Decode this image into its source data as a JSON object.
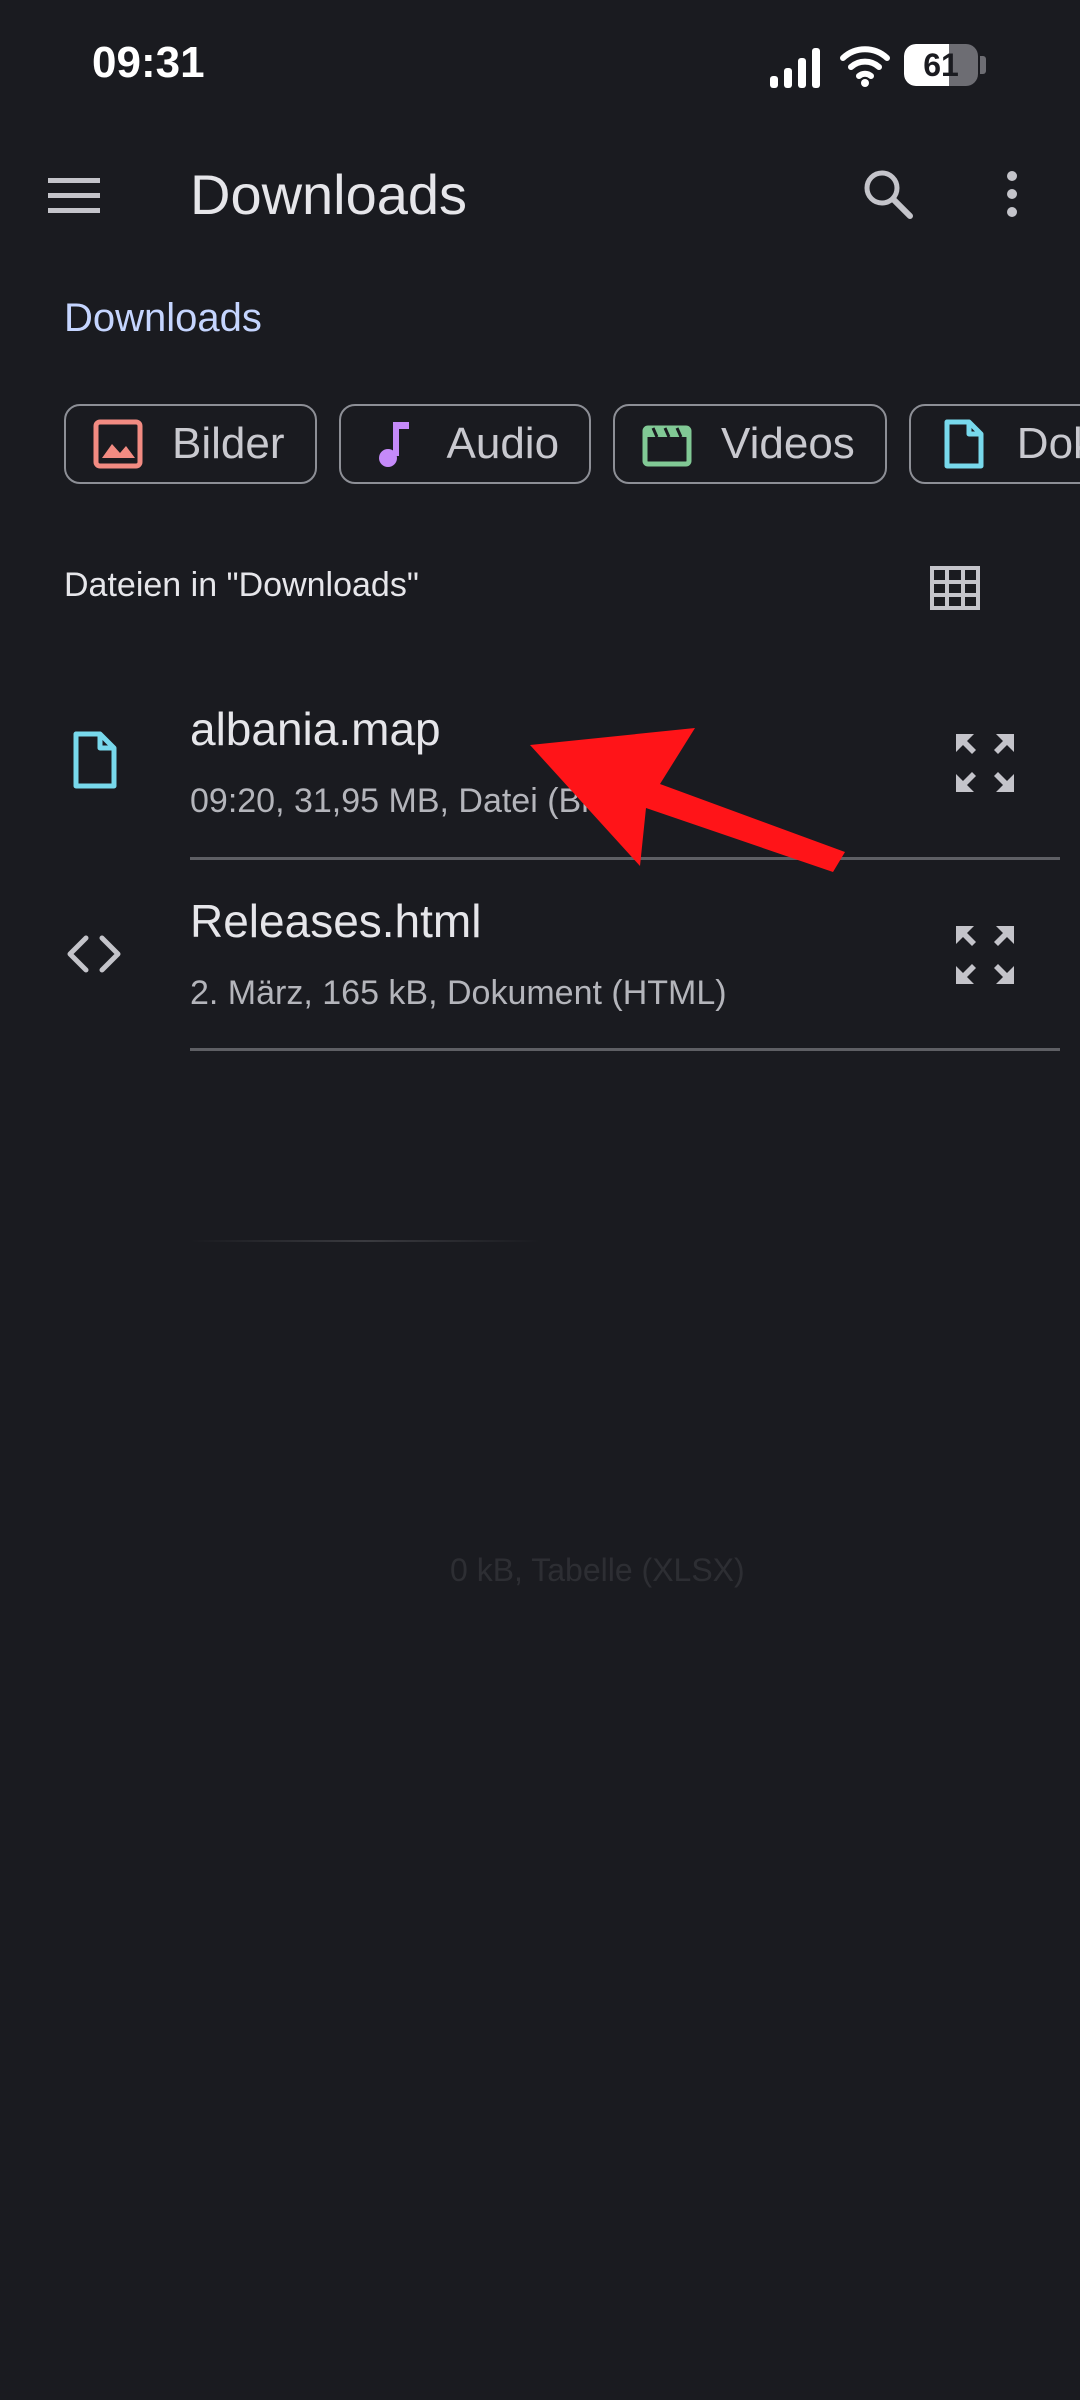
{
  "status_bar": {
    "time": "09:31",
    "battery": "61",
    "battery_level": 0.61
  },
  "app_bar": {
    "title": "Downloads"
  },
  "section": {
    "title": "Downloads"
  },
  "chips": [
    {
      "label": "Bilder",
      "icon": "image-icon",
      "color": "#f28b82"
    },
    {
      "label": "Audio",
      "icon": "music-note-icon",
      "color": "#c58af9"
    },
    {
      "label": "Videos",
      "icon": "movie-icon",
      "color": "#81c995"
    },
    {
      "label": "Dok",
      "icon": "document-icon",
      "color": "#78d9ec"
    }
  ],
  "list": {
    "heading": "Dateien in \"Downloads\"",
    "items": [
      {
        "name": "albania.map",
        "meta": "09:20, 31,95 MB, Datei (Bi",
        "icon": "file-icon"
      },
      {
        "name": "Releases.html",
        "meta": "2. März, 165 kB, Dokument (HTML)",
        "icon": "code-icon"
      }
    ]
  },
  "ghost": {
    "text": "0 kB, Tabelle (XLSX)"
  },
  "annotation": {
    "arrow_color": "#ff1418"
  }
}
